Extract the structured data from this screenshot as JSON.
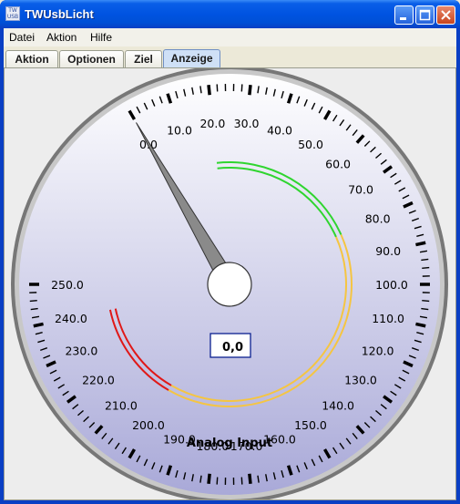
{
  "window": {
    "title": "TWUsbLicht",
    "icon_label": "TW USB"
  },
  "menubar": {
    "items": [
      "Datei",
      "Aktion",
      "Hilfe"
    ]
  },
  "tabs": [
    {
      "label": "Aktion",
      "active": false
    },
    {
      "label": "Optionen",
      "active": false
    },
    {
      "label": "Ziel",
      "active": false
    },
    {
      "label": "Anzeige",
      "active": true
    }
  ],
  "gauge": {
    "label": "Analog Input",
    "value": 0,
    "value_display": "0,0",
    "min": 0,
    "max": 250,
    "tick_labels": [
      "0.0",
      "10.0",
      "20.0",
      "30.0",
      "40.0",
      "50.0",
      "60.0",
      "70.0",
      "80.0",
      "90.0",
      "100.0",
      "110.0",
      "120.0",
      "130.0",
      "140.0",
      "150.0",
      "160.0",
      "170.0",
      "180.0",
      "190.0",
      "200.0",
      "210.0",
      "220.0",
      "230.0",
      "240.0",
      "250.0"
    ],
    "zones": [
      {
        "name": "green",
        "from": 20,
        "to": 80,
        "color": "#2fd52f"
      },
      {
        "name": "yellow",
        "from": 80,
        "to": 200,
        "color": "#f5c542"
      },
      {
        "name": "red",
        "from": 200,
        "to": 240,
        "color": "#e01818"
      }
    ],
    "needle_color": "#8a8a8a",
    "face_color_top": "#ffffff",
    "face_color_bottom": "#a9a9d8"
  }
}
